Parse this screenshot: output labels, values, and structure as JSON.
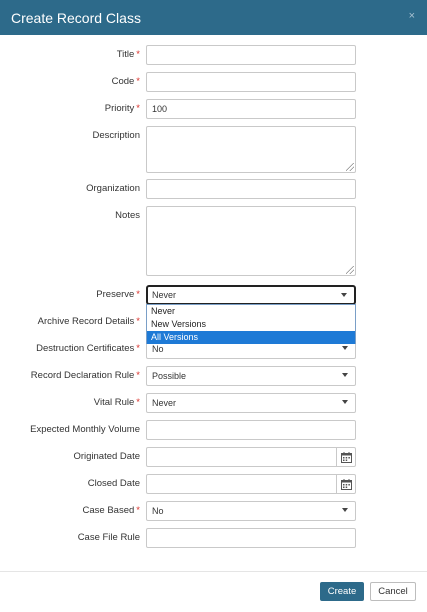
{
  "dialog": {
    "title": "Create Record Class",
    "close_glyph": "×"
  },
  "fields": {
    "title": {
      "label": "Title",
      "required": true,
      "value": ""
    },
    "code": {
      "label": "Code",
      "required": true,
      "value": ""
    },
    "priority": {
      "label": "Priority",
      "required": true,
      "value": "100"
    },
    "description": {
      "label": "Description",
      "required": false,
      "value": ""
    },
    "organization": {
      "label": "Organization",
      "required": false,
      "value": ""
    },
    "notes": {
      "label": "Notes",
      "required": false,
      "value": ""
    },
    "preserve": {
      "label": "Preserve",
      "required": true,
      "value": "Never",
      "open": true,
      "options": [
        "Never",
        "New Versions",
        "All Versions"
      ],
      "highlighted": "All Versions"
    },
    "archive_record_details": {
      "label": "Archive Record Details",
      "required": true,
      "value": ""
    },
    "destruction_certificates": {
      "label": "Destruction Certificates",
      "required": true,
      "value": "No"
    },
    "record_declaration_rule": {
      "label": "Record Declaration Rule",
      "required": true,
      "value": "Possible"
    },
    "vital_rule": {
      "label": "Vital Rule",
      "required": true,
      "value": "Never"
    },
    "expected_monthly_volume": {
      "label": "Expected Monthly Volume",
      "required": false,
      "value": ""
    },
    "originated_date": {
      "label": "Originated Date",
      "required": false,
      "value": ""
    },
    "closed_date": {
      "label": "Closed Date",
      "required": false,
      "value": ""
    },
    "case_based": {
      "label": "Case Based",
      "required": true,
      "value": "No"
    },
    "case_file_rule": {
      "label": "Case File Rule",
      "required": false,
      "value": ""
    }
  },
  "required_marker": "*",
  "footer": {
    "create_label": "Create",
    "cancel_label": "Cancel"
  },
  "colors": {
    "header_bg": "#2d6a8a",
    "required": "#d9302a",
    "highlight": "#1e7ad6"
  },
  "icons": {
    "calendar": "calendar-icon",
    "dropdown": "chevron-down-icon",
    "close": "close-icon"
  }
}
